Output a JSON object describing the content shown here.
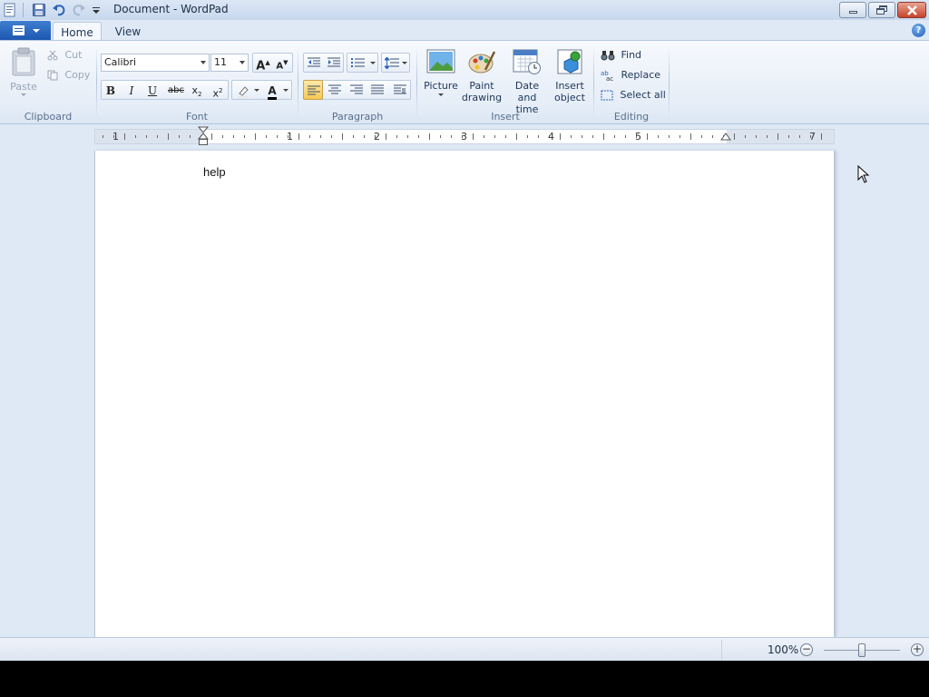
{
  "window": {
    "title": "Document - WordPad"
  },
  "tabs": [
    {
      "label": "Home",
      "active": true
    },
    {
      "label": "View",
      "active": false
    }
  ],
  "clipboard": {
    "paste_label": "Paste",
    "cut_label": "Cut",
    "copy_label": "Copy",
    "group_label": "Clipboard"
  },
  "font": {
    "family": "Calibri",
    "size": "11",
    "group_label": "Font"
  },
  "paragraph": {
    "group_label": "Paragraph"
  },
  "insert": {
    "picture_label": "Picture",
    "paint_label_1": "Paint",
    "paint_label_2": "drawing",
    "datetime_label_1": "Date and",
    "datetime_label_2": "time",
    "object_label_1": "Insert",
    "object_label_2": "object",
    "group_label": "Insert"
  },
  "editing": {
    "find_label": "Find",
    "replace_label": "Replace",
    "selectall_label": "Select all",
    "group_label": "Editing"
  },
  "ruler": {
    "numbers": [
      "1",
      "1",
      "2",
      "3",
      "4",
      "5",
      "7"
    ]
  },
  "document": {
    "text": "help"
  },
  "status": {
    "zoom": "100%"
  }
}
